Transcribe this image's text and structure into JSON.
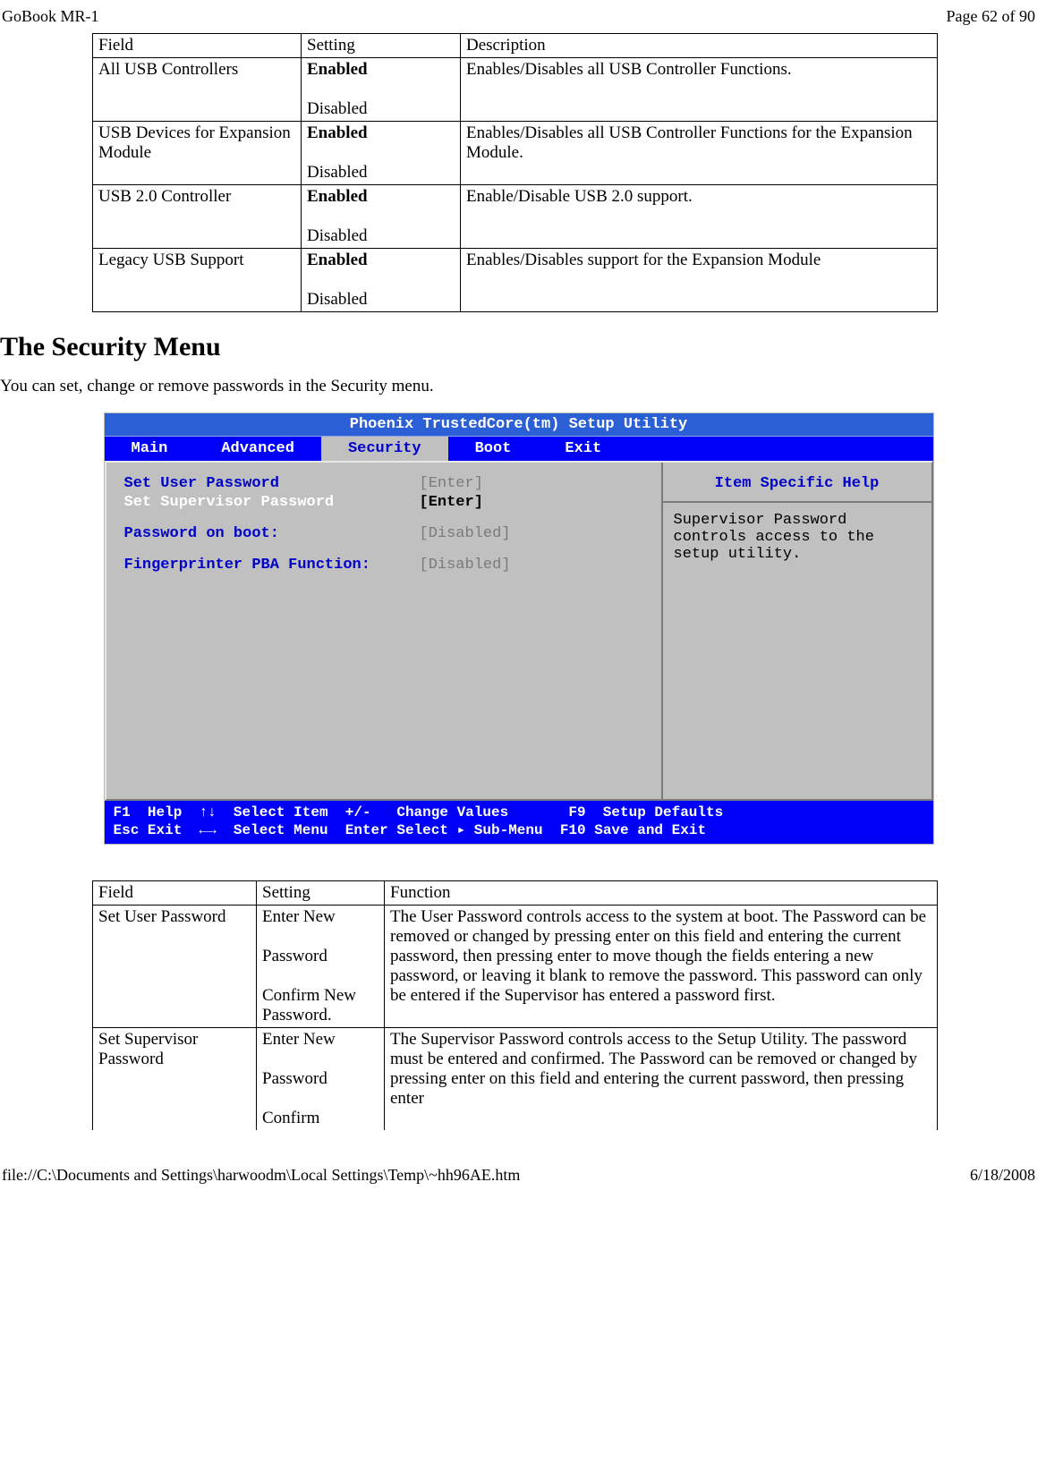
{
  "meta": {
    "doc_title": "GoBook MR-1",
    "page_no": "Page 62 of 90",
    "file_path": "file://C:\\Documents and Settings\\harwoodm\\Local Settings\\Temp\\~hh96AE.htm",
    "date": "6/18/2008"
  },
  "usb_table": {
    "headers": {
      "field": "Field",
      "setting": "Setting",
      "desc": "Description"
    },
    "rows": [
      {
        "field": "All USB Controllers",
        "setting_bold": "Enabled",
        "setting_plain": "Disabled",
        "desc": "Enables/Disables all USB Controller Functions."
      },
      {
        "field": "USB Devices for Expansion Module",
        "setting_bold": "Enabled",
        "setting_plain": "Disabled",
        "desc": "Enables/Disables all USB Controller Functions for the Expansion Module."
      },
      {
        "field": "USB 2.0 Controller",
        "setting_bold": "Enabled",
        "setting_plain": "Disabled",
        "desc": "Enable/Disable USB 2.0 support."
      },
      {
        "field": "Legacy USB Support",
        "setting_bold": "Enabled",
        "setting_plain": "Disabled",
        "desc": "Enables/Disables support for the Expansion Module"
      }
    ]
  },
  "section": {
    "title": "The Security Menu",
    "lead": "You can set, change or remove passwords in the Security menu."
  },
  "bios": {
    "title": "Phoenix TrustedCore(tm) Setup Utility",
    "tabs": {
      "main": "Main",
      "advanced": "Advanced",
      "security": "Security",
      "boot": "Boot",
      "exit": "Exit"
    },
    "rows": {
      "r1_label": "Set User Password",
      "r1_val": "[Enter]",
      "r2_label": "Set Supervisor Password",
      "r2_val": "[Enter]",
      "r3_label": "Password on boot:",
      "r3_val": "[Disabled]",
      "r4_label": "Fingerprinter PBA Function:",
      "r4_val": "[Disabled]"
    },
    "help": {
      "title": "Item Specific Help",
      "body": "Supervisor Password controls access to the setup utility."
    },
    "footer": {
      "line1": "F1  Help  ↑↓  Select Item  +/-   Change Values       F9  Setup Defaults",
      "line2": "Esc Exit  ←→  Select Menu  Enter Select ▸ Sub-Menu  F10 Save and Exit"
    }
  },
  "sec_table": {
    "headers": {
      "field": "Field",
      "setting": "Setting",
      "func": "Function"
    },
    "rows": [
      {
        "field": "Set User Password",
        "setting": "Enter New\n\nPassword\n\nConfirm New Password.",
        "func": "The User Password controls access to the system at boot. The Password can be removed or changed  by pressing enter on this field and entering the current password, then pressing enter to move though the fields entering a new password, or leaving it blank to remove the password.  This password can only be entered if the Supervisor has entered a password first."
      },
      {
        "field": "Set Supervisor Password",
        "setting": "Enter New\n\nPassword\n\nConfirm",
        "func": "The Supervisor Password controls access to the Setup Utility.  The password must be entered and confirmed.  The Password can be removed or changed  by pressing enter on this field and entering the current password, then pressing enter"
      }
    ]
  }
}
